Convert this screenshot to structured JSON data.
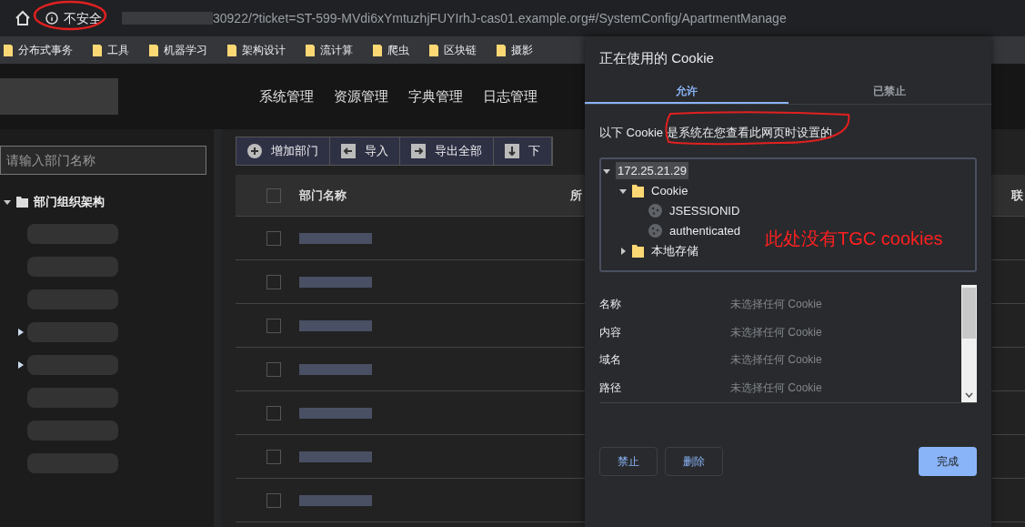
{
  "address_bar": {
    "security_label": "不安全",
    "url": "30922/?ticket=ST-599-MVdi6xYmtuzhjFUYIrhJ-cas01.example.org#/SystemConfig/ApartmentManage"
  },
  "bookmarks": [
    "分布式事务",
    "工具",
    "机器学习",
    "架构设计",
    "流计算",
    "爬虫",
    "区块链",
    "摄影"
  ],
  "nav": [
    "系统管理",
    "资源管理",
    "字典管理",
    "日志管理"
  ],
  "sidebar": {
    "search": {
      "placeholder": "请输入部门名称"
    },
    "tree": {
      "label": "部门组织架构",
      "expanded": true,
      "children": [
        {
          "expandable": false
        },
        {
          "expandable": false
        },
        {
          "expandable": false
        },
        {
          "expandable": true
        },
        {
          "expandable": true
        },
        {
          "expandable": false
        },
        {
          "expandable": false
        },
        {
          "expandable": false
        }
      ]
    }
  },
  "toolbar": [
    {
      "kind": "add",
      "label": "增加部门"
    },
    {
      "kind": "import",
      "label": "导入"
    },
    {
      "kind": "export",
      "label": "导出全部"
    },
    {
      "kind": "download",
      "label": "下"
    }
  ],
  "table": {
    "header_checked": false,
    "columns": [
      "部门名称",
      "所",
      "联"
    ],
    "rows": [
      {
        "checked": false
      },
      {
        "checked": false
      },
      {
        "checked": false
      },
      {
        "checked": false
      },
      {
        "checked": false
      },
      {
        "checked": false
      },
      {
        "checked": false
      }
    ]
  },
  "dialog": {
    "title": "正在使用的 Cookie",
    "tabs": [
      {
        "label": "允许",
        "selected": true
      },
      {
        "label": "已禁止",
        "selected": false
      }
    ],
    "description": "以下 Cookie 是系统在您查看此网页时设置的",
    "tree": {
      "label": "172.25.21.29",
      "selected": true,
      "expanded": true,
      "children": [
        {
          "kind": "folder",
          "label": "Cookie",
          "selected": false,
          "expanded": true,
          "children": [
            {
              "kind": "cookie",
              "label": "JSESSIONID",
              "selected": false
            },
            {
              "kind": "cookie",
              "label": "authenticated",
              "selected": false
            }
          ]
        },
        {
          "kind": "folder",
          "label": "本地存储",
          "selected": false,
          "expanded": false
        }
      ]
    },
    "details": [
      {
        "label": "名称",
        "value": "未选择任何 Cookie"
      },
      {
        "label": "内容",
        "value": "未选择任何 Cookie"
      },
      {
        "label": "域名",
        "value": "未选择任何 Cookie"
      },
      {
        "label": "路径",
        "value": "未选择任何 Cookie"
      }
    ],
    "buttons": [
      {
        "kind": "secondary",
        "label": "禁止"
      },
      {
        "kind": "secondary",
        "label": "删除"
      },
      {
        "kind": "primary",
        "label": "完成"
      }
    ]
  },
  "annotation": "此处没有TGC cookies"
}
